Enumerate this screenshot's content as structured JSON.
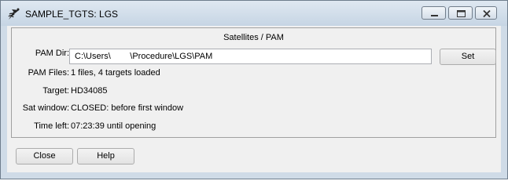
{
  "window": {
    "title": "SAMPLE_TGTS: LGS"
  },
  "panel": {
    "title": "Satellites / PAM",
    "pam_dir_label": "PAM Dir:",
    "pam_dir_value": "C:\\Users\\        \\Procedure\\LGS\\PAM",
    "set_label": "Set",
    "pam_files_label": "PAM Files:",
    "pam_files_value": "1 files, 4 targets loaded",
    "target_label": "Target:",
    "target_value": "HD34085",
    "sat_window_label": "Sat window:",
    "sat_window_value": "CLOSED: before first window",
    "time_left_label": "Time left:",
    "time_left_value": "07:23:39 until opening"
  },
  "buttons": {
    "close_label": "Close",
    "help_label": "Help"
  },
  "icons": {
    "app": "satellite-icon",
    "minimize": "minimize-icon",
    "maximize": "maximize-icon",
    "close": "close-icon"
  }
}
